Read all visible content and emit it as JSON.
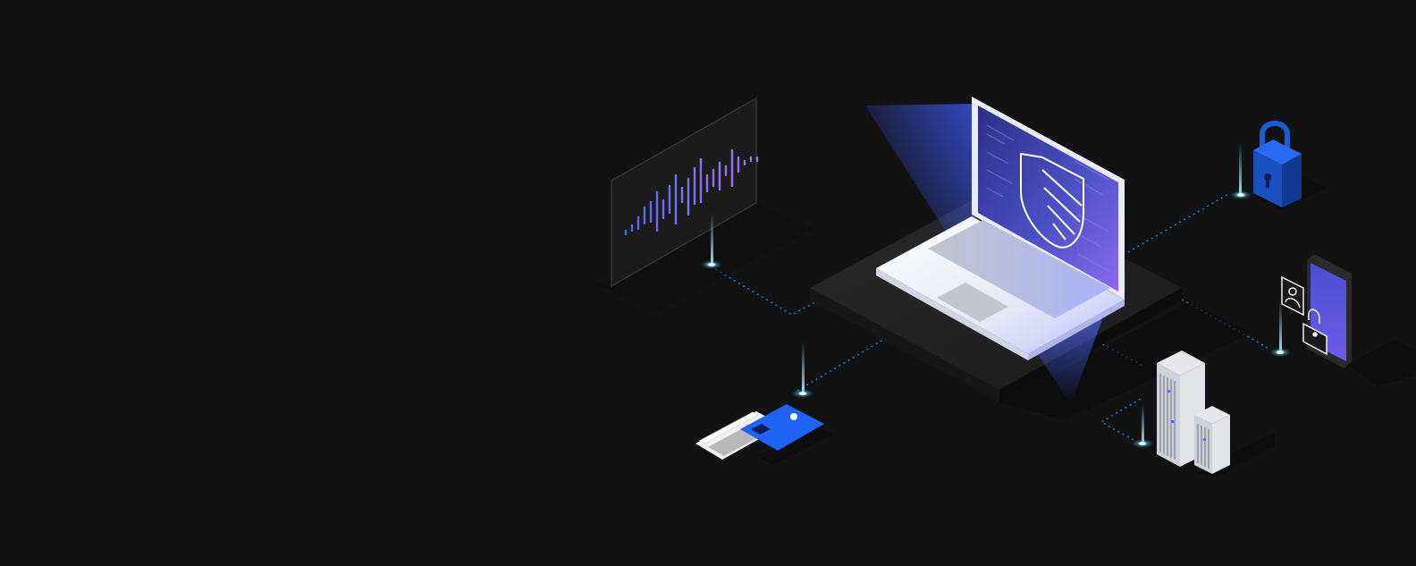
{
  "scene": {
    "background": "#121212",
    "accent_blue": "#0f62fe",
    "accent_purple": "#8a6bf0",
    "glow_cyan": "#7fe3ff",
    "connector_color": "#1f78c8",
    "nodes": [
      {
        "name": "audio-waveform-panel",
        "icon": "waveform-icon"
      },
      {
        "name": "laptop",
        "icon": "shield-icon"
      },
      {
        "name": "padlock",
        "icon": "lock-icon"
      },
      {
        "name": "mobile-device",
        "icon": "identity-lock-icon"
      },
      {
        "name": "payment-cards",
        "icon": "credit-card-icon"
      },
      {
        "name": "data-center",
        "icon": "server-icon"
      }
    ]
  }
}
